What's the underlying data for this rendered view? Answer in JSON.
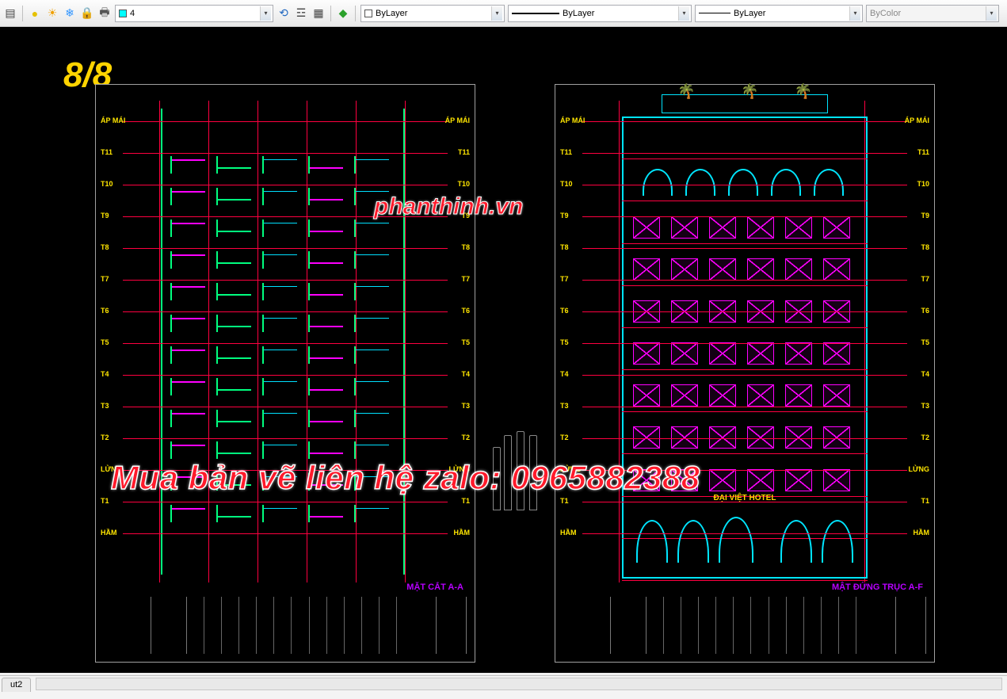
{
  "toolbar": {
    "layer_current": "4",
    "color_dropdown": "ByLayer",
    "linetype_dropdown": "ByLayer",
    "lineweight_dropdown": "ByLayer",
    "plotstyle_dropdown": "ByColor"
  },
  "canvas": {
    "top_corner_label": "8/8"
  },
  "drawings": {
    "left": {
      "title": "MẶT CẮT A-A",
      "floors": [
        "ÁP MÁI",
        "T11",
        "T10",
        "T9",
        "T8",
        "T7",
        "T6",
        "T5",
        "T4",
        "T3",
        "T2",
        "LỬNG",
        "T1",
        "HẦM"
      ]
    },
    "right": {
      "title": "MẬT ĐỨNG TRỤC A-F",
      "floors": [
        "ÁP MÁI",
        "T11",
        "T10",
        "T9",
        "T8",
        "T7",
        "T6",
        "T5",
        "T4",
        "T3",
        "T2",
        "LỬNG",
        "T1",
        "HẦM"
      ],
      "sign_text": "ĐẠI VIỆT HOTEL"
    }
  },
  "watermark": {
    "site": "phanthinh.vn",
    "contact": "Mua bản vẽ liên hệ zalo: 0965882388"
  },
  "tabs": {
    "layout_tab": "ut2"
  }
}
